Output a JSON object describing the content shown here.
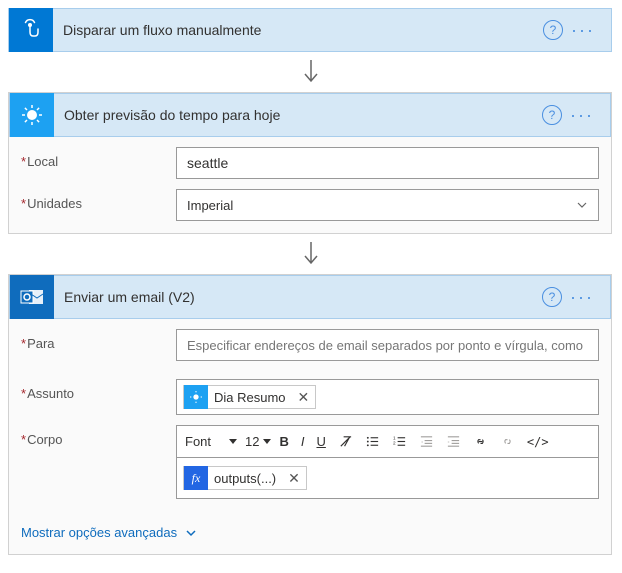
{
  "step1": {
    "title": "Disparar um fluxo manualmente",
    "iconName": "touch-icon"
  },
  "step2": {
    "title": "Obter previsão do tempo para hoje",
    "fields": {
      "localLabel": "Local",
      "localValue": "seattle",
      "unidadesLabel": "Unidades",
      "unidadesValue": "Imperial"
    }
  },
  "step3": {
    "title": "Enviar um email (V2)",
    "fields": {
      "paraLabel": "Para",
      "paraPlaceholder": "Especificar endereços de email separados por ponto e vírgula, como",
      "assuntoLabel": "Assunto",
      "tokenText": "Dia Resumo",
      "corpoLabel": "Corpo",
      "fontLabel": "Font",
      "fontSize": "12",
      "fxToken": "outputs(...)"
    },
    "advancedLink": "Mostrar opções avançadas"
  },
  "asterisk": "*"
}
